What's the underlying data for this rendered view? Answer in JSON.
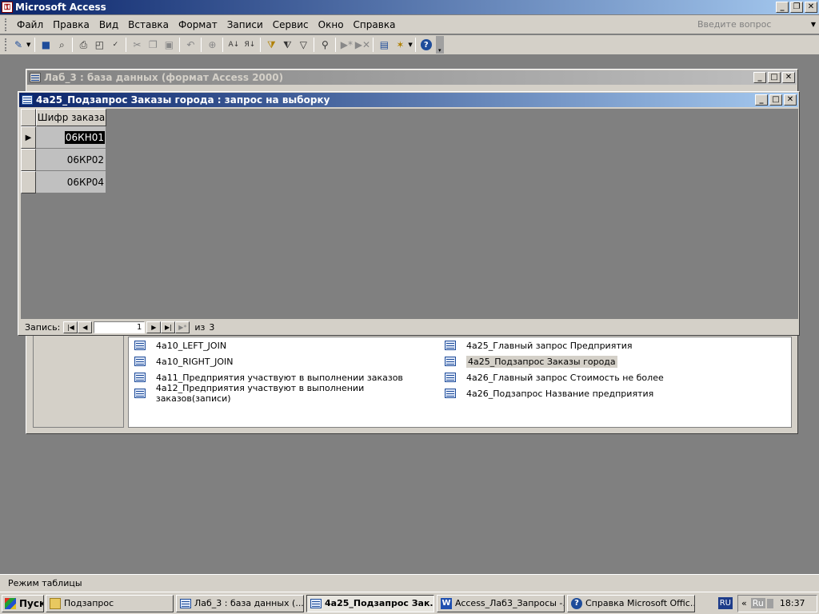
{
  "app": {
    "title": "Microsoft Access"
  },
  "menu": {
    "items": [
      "Файл",
      "Правка",
      "Вид",
      "Вставка",
      "Формат",
      "Записи",
      "Сервис",
      "Окно",
      "Справка"
    ],
    "help_placeholder": "Введите вопрос"
  },
  "toolbar": {
    "icons": [
      "view-icon",
      "save-icon",
      "search-file-icon",
      "print-icon",
      "print-preview-icon",
      "spelling-icon",
      "cut-icon",
      "copy-icon",
      "paste-icon",
      "undo-icon",
      "hyperlink-icon",
      "sort-ascending-icon",
      "sort-descending-icon",
      "filter-by-selection-icon",
      "filter-by-form-icon",
      "apply-filter-icon",
      "find-icon",
      "new-record-icon",
      "delete-record-icon",
      "database-window-icon",
      "new-object-icon",
      "help-icon"
    ]
  },
  "db_window": {
    "title": "Лаб_3 : база данных (формат Access 2000)",
    "left_column": [
      "4а10_LEFT_JOIN",
      "4а10_RIGHT_JOIN",
      "4а11_Предприятия участвуют в выполнении заказов",
      "4а12_Предприятия участвуют в выполнении заказов(записи)"
    ],
    "right_column": [
      "4а25_Главный запрос Предприятия",
      "4а25_Подзапрос Заказы города",
      "4а26_Главный запрос Стоимость не более",
      "4а26_Подзапрос Название предприятия"
    ],
    "selected_item": "4а25_Подзапрос Заказы города"
  },
  "query_window": {
    "title": "4а25_Подзапрос Заказы города : запрос на выборку",
    "column_header": "Шифр заказа",
    "rows": [
      "06КН01",
      "06КР02",
      "06КР04"
    ],
    "record_label": "Запись:",
    "current_record": "1",
    "of_label": "из",
    "total_records": "3"
  },
  "status_bar": {
    "text": "Режим таблицы"
  },
  "taskbar": {
    "start": "Пуск",
    "buttons": [
      {
        "label": "Подзапрос",
        "icon": "folder-icon"
      },
      {
        "label": "Лаб_3 : база данных (...",
        "icon": "access-db-icon"
      },
      {
        "label": "4а25_Подзапрос Зак...",
        "icon": "access-query-icon"
      },
      {
        "label": "Access_Лаб3_Запросы -...",
        "icon": "word-icon"
      },
      {
        "label": "Справка Microsoft Offic...",
        "icon": "help-icon"
      }
    ],
    "lang": "RU",
    "tray_lang": "Ru",
    "clock": "18:37"
  },
  "colors": {
    "titlebar_active": "#0a246a",
    "titlebar_inactive": "#808080",
    "face": "#d4d0c8",
    "mdi_background": "#808080",
    "selection": "#000000"
  }
}
